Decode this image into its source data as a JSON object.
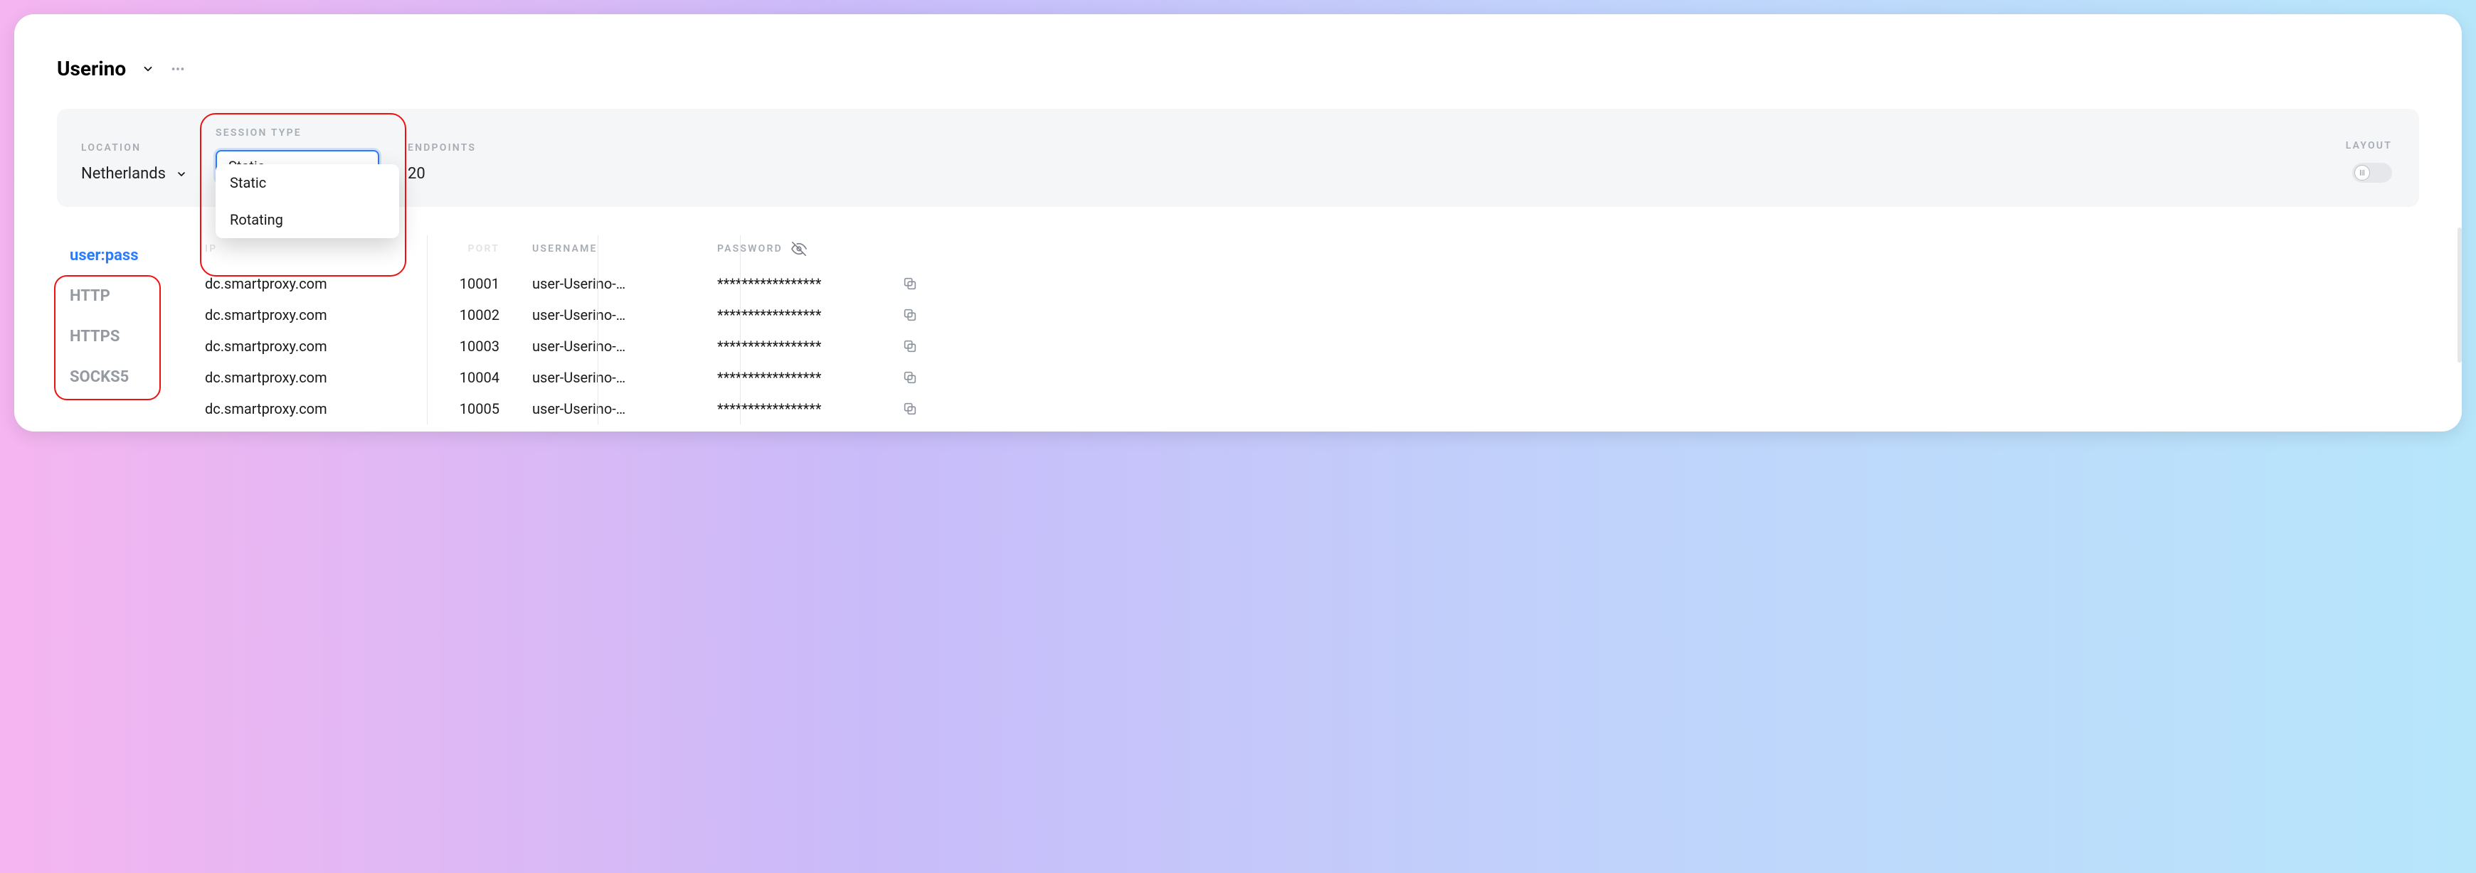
{
  "header": {
    "title": "Userino"
  },
  "filters": {
    "location": {
      "label": "LOCATION",
      "value": "Netherlands"
    },
    "session": {
      "label": "SESSION TYPE",
      "value": "Static",
      "options": [
        "Static",
        "Rotating"
      ]
    },
    "endpoints": {
      "label": "ENDPOINTS",
      "value": "20"
    },
    "layout": {
      "label": "LAYOUT"
    }
  },
  "sidebar": {
    "items": [
      {
        "label": "user:pass",
        "active": true
      },
      {
        "label": "HTTP",
        "active": false
      },
      {
        "label": "HTTPS",
        "active": false
      },
      {
        "label": "SOCKS5",
        "active": false
      }
    ]
  },
  "table": {
    "columns": {
      "ip": "IP",
      "port": "PORT",
      "username": "USERNAME",
      "password": "PASSWORD"
    },
    "rows": [
      {
        "host": "dc.smartproxy.com",
        "port": "10001",
        "user": "user-Userino-…",
        "pass": "*****************"
      },
      {
        "host": "dc.smartproxy.com",
        "port": "10002",
        "user": "user-Userino-…",
        "pass": "*****************"
      },
      {
        "host": "dc.smartproxy.com",
        "port": "10003",
        "user": "user-Userino-…",
        "pass": "*****************"
      },
      {
        "host": "dc.smartproxy.com",
        "port": "10004",
        "user": "user-Userino-…",
        "pass": "*****************"
      },
      {
        "host": "dc.smartproxy.com",
        "port": "10005",
        "user": "user-Userino-…",
        "pass": "*****************"
      }
    ]
  }
}
